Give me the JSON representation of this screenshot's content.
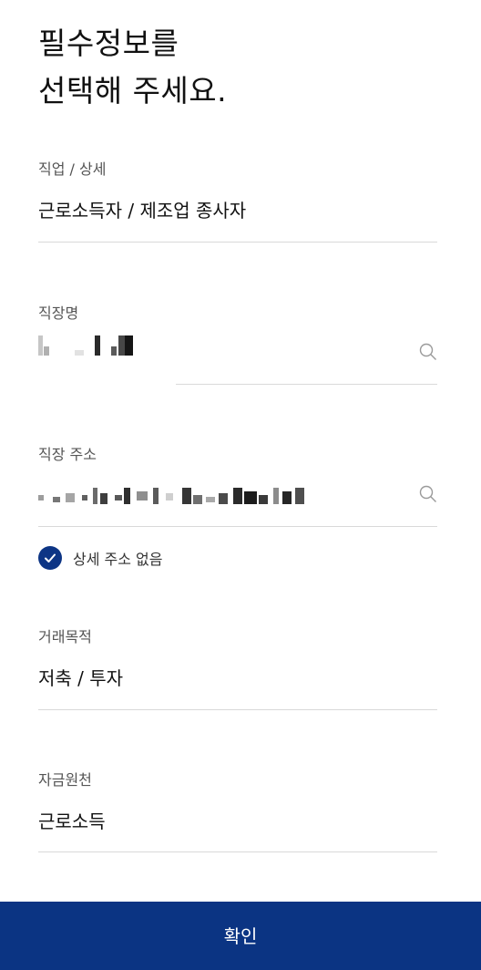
{
  "title": {
    "line1": "필수정보를",
    "line2": "선택해 주세요."
  },
  "occupation": {
    "label": "직업 / 상세",
    "value": "근로소득자 / 제조업 종사자"
  },
  "workplace": {
    "label": "직장명",
    "icon": "search-icon"
  },
  "workplace_address": {
    "label": "직장 주소",
    "icon": "search-icon"
  },
  "no_detail_address": {
    "label": "상세 주소 없음",
    "checked": true,
    "icon": "check-icon"
  },
  "purpose": {
    "label": "거래목적",
    "value": "저축 / 투자"
  },
  "fund_source": {
    "label": "자금원천",
    "value": "근로소득"
  },
  "confirm_button": {
    "label": "확인"
  },
  "colors": {
    "accent": "#0b3483",
    "check": "#0d3585",
    "divider": "#d9d9d9",
    "label": "#555555"
  }
}
